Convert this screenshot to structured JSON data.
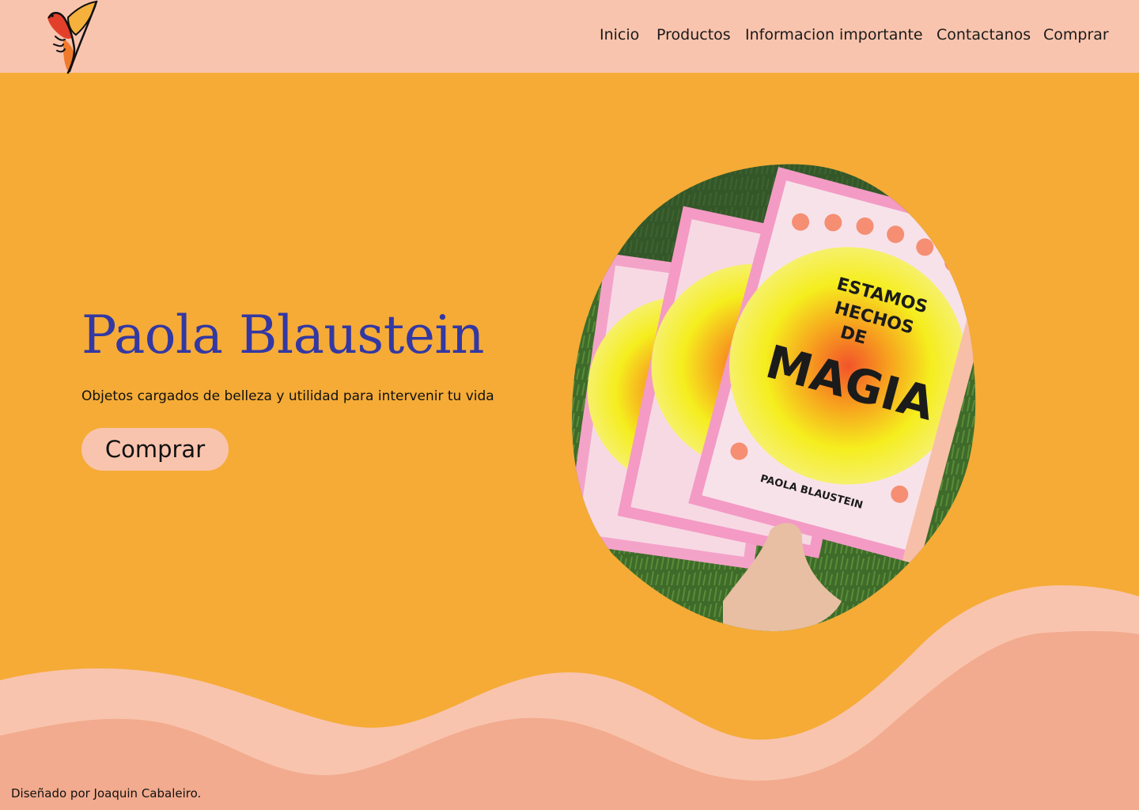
{
  "header": {
    "logo_icon": "bird-logo-icon",
    "nav": [
      {
        "label": "Inicio"
      },
      {
        "label": "Productos"
      },
      {
        "label": "Informacion importante"
      },
      {
        "label": "Contactanos"
      },
      {
        "label": "Comprar"
      }
    ]
  },
  "hero": {
    "title": "Paola Blaustein",
    "subtitle": "Objetos cargados de belleza y utilidad para intervenir tu vida",
    "button_label": "Comprar"
  },
  "photo": {
    "book_title_line1": "ESTAMOS",
    "book_title_line2": "HECHOS",
    "book_title_line3": "DE",
    "book_title_line4": "MAGIA",
    "book_author": "PAOLA BLAUSTEIN"
  },
  "footer": {
    "credit": "Diseñado por Joaquin Cabaleiro."
  },
  "colors": {
    "background": "#F5AB36",
    "header": "#F9C4AE",
    "title": "#3338A3",
    "wave_light": "#F9C4AE",
    "wave_dark": "#F2AB8E"
  }
}
